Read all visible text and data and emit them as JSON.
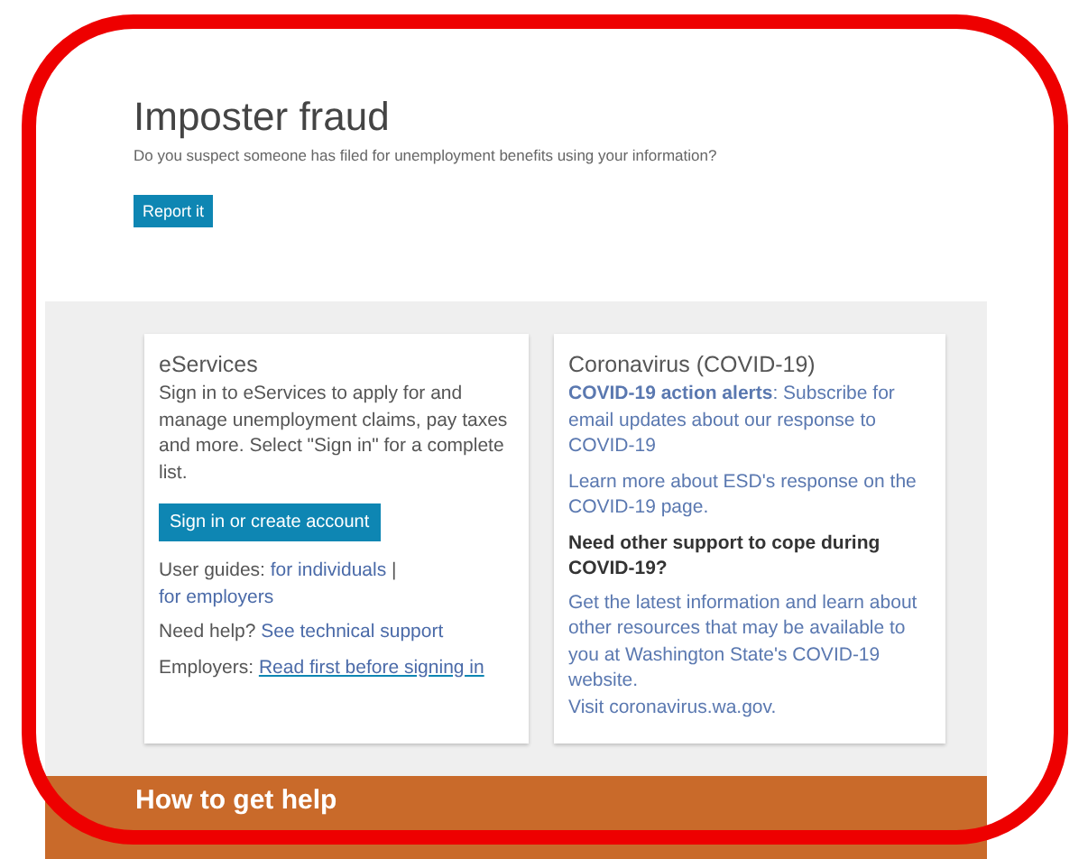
{
  "hero": {
    "title": "Imposter fraud",
    "subtitle": "Do you suspect someone has filed for unemployment benefits using your information?",
    "button": "Report it"
  },
  "eservices": {
    "title": "eServices",
    "text": "Sign in to eServices to apply for and manage unemployment claims, pay taxes and more. Select \"Sign in\" for a complete list.",
    "button": "Sign in or create account",
    "lines": [
      [
        {
          "kind": "plain",
          "text": "User guides:"
        },
        {
          "kind": "link",
          "text": "for individuals"
        },
        {
          "kind": "plain",
          "text": "|"
        },
        {
          "kind": "link",
          "text": "for employers"
        }
      ],
      [
        {
          "kind": "plain",
          "text": "Need help?"
        },
        {
          "kind": "link",
          "text": "See technical support"
        }
      ],
      [
        {
          "kind": "plain",
          "text": "Employers:"
        },
        {
          "kind": "underlined",
          "text": "Read first before signing in"
        }
      ]
    ]
  },
  "covid": {
    "title": "Coronavirus (COVID-19)",
    "blocks": [
      {
        "kind": "link",
        "text": "**COVID-19 action alerts**: Subscribe for email updates about our response to COVID-19"
      },
      {
        "kind": "link",
        "text": "Learn more about ESD's response on the COVID-19 page."
      },
      {
        "kind": "heading",
        "text": "Need other support to cope during COVID-19?"
      },
      {
        "kind": "link",
        "text": "Get the latest information and learn about other resources that may be available to you at Washington State's COVID-19 website."
      },
      {
        "kind": "tight-link",
        "text": "Visit coronavirus.wa.gov."
      }
    ]
  },
  "help": {
    "title": "How to get help"
  }
}
